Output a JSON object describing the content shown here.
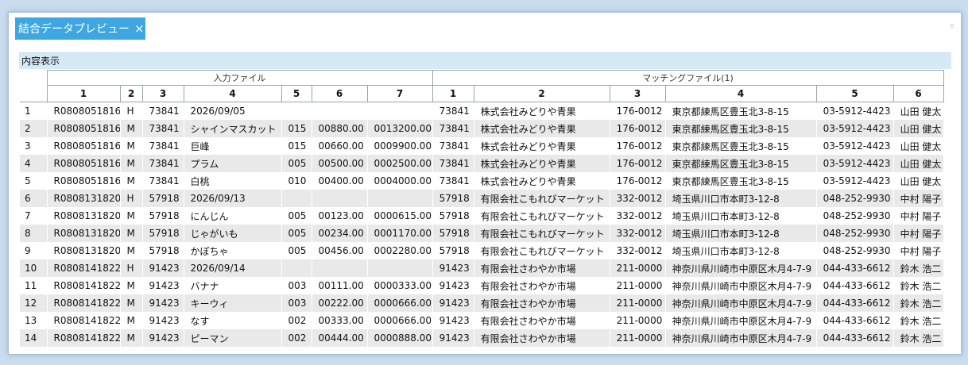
{
  "tab": {
    "title": "結合データプレビュー",
    "close_glyph": "×"
  },
  "tab_menu_glyph": "▿",
  "section": {
    "title": "内容表示"
  },
  "grid": {
    "groups": [
      {
        "label": "入力ファイル"
      },
      {
        "label": "マッチングファイル(1)"
      }
    ],
    "input_columns": [
      "1",
      "2",
      "3",
      "4",
      "5",
      "6",
      "7"
    ],
    "match_columns": [
      "1",
      "2",
      "3",
      "4",
      "5",
      "6"
    ],
    "rows": [
      [
        "1",
        "R0808051816",
        "H",
        "73841",
        "2026/09/05",
        "",
        "",
        "",
        "73841",
        "株式会社みどりや青果",
        "176-0012",
        "東京都練馬区豊玉北3-8-15",
        "03-5912-4423",
        "山田 健太"
      ],
      [
        "2",
        "R0808051816",
        "M",
        "73841",
        "シャインマスカット",
        "015",
        "00880.00",
        "0013200.00",
        "73841",
        "株式会社みどりや青果",
        "176-0012",
        "東京都練馬区豊玉北3-8-15",
        "03-5912-4423",
        "山田 健太"
      ],
      [
        "3",
        "R0808051816",
        "M",
        "73841",
        "巨峰",
        "015",
        "00660.00",
        "0009900.00",
        "73841",
        "株式会社みどりや青果",
        "176-0012",
        "東京都練馬区豊玉北3-8-15",
        "03-5912-4423",
        "山田 健太"
      ],
      [
        "4",
        "R0808051816",
        "M",
        "73841",
        "プラム",
        "005",
        "00500.00",
        "0002500.00",
        "73841",
        "株式会社みどりや青果",
        "176-0012",
        "東京都練馬区豊玉北3-8-15",
        "03-5912-4423",
        "山田 健太"
      ],
      [
        "5",
        "R0808051816",
        "M",
        "73841",
        "白桃",
        "010",
        "00400.00",
        "0004000.00",
        "73841",
        "株式会社みどりや青果",
        "176-0012",
        "東京都練馬区豊玉北3-8-15",
        "03-5912-4423",
        "山田 健太"
      ],
      [
        "6",
        "R0808131820",
        "H",
        "57918",
        "2026/09/13",
        "",
        "",
        "",
        "57918",
        "有限会社こもれびマーケット",
        "332-0012",
        "埼玉県川口市本町3-12-8",
        "048-252-9930",
        "中村 陽子"
      ],
      [
        "7",
        "R0808131820",
        "M",
        "57918",
        "にんじん",
        "005",
        "00123.00",
        "0000615.00",
        "57918",
        "有限会社こもれびマーケット",
        "332-0012",
        "埼玉県川口市本町3-12-8",
        "048-252-9930",
        "中村 陽子"
      ],
      [
        "8",
        "R0808131820",
        "M",
        "57918",
        "じゃがいも",
        "005",
        "00234.00",
        "0001170.00",
        "57918",
        "有限会社こもれびマーケット",
        "332-0012",
        "埼玉県川口市本町3-12-8",
        "048-252-9930",
        "中村 陽子"
      ],
      [
        "9",
        "R0808131820",
        "M",
        "57918",
        "かぼちゃ",
        "005",
        "00456.00",
        "0002280.00",
        "57918",
        "有限会社こもれびマーケット",
        "332-0012",
        "埼玉県川口市本町3-12-8",
        "048-252-9930",
        "中村 陽子"
      ],
      [
        "10",
        "R0808141822",
        "H",
        "91423",
        "2026/09/14",
        "",
        "",
        "",
        "91423",
        "有限会社さわやか市場",
        "211-0000",
        "神奈川県川崎市中原区木月4-7-9",
        "044-433-6612",
        "鈴木 浩二"
      ],
      [
        "11",
        "R0808141822",
        "M",
        "91423",
        "バナナ",
        "003",
        "00111.00",
        "0000333.00",
        "91423",
        "有限会社さわやか市場",
        "211-0000",
        "神奈川県川崎市中原区木月4-7-9",
        "044-433-6612",
        "鈴木 浩二"
      ],
      [
        "12",
        "R0808141822",
        "M",
        "91423",
        "キーウィ",
        "003",
        "00222.00",
        "0000666.00",
        "91423",
        "有限会社さわやか市場",
        "211-0000",
        "神奈川県川崎市中原区木月4-7-9",
        "044-433-6612",
        "鈴木 浩二"
      ],
      [
        "13",
        "R0808141822",
        "M",
        "91423",
        "なす",
        "002",
        "00333.00",
        "0000666.00",
        "91423",
        "有限会社さわやか市場",
        "211-0000",
        "神奈川県川崎市中原区木月4-7-9",
        "044-433-6612",
        "鈴木 浩二"
      ],
      [
        "14",
        "R0808141822",
        "M",
        "91423",
        "ピーマン",
        "002",
        "00444.00",
        "0000888.00",
        "91423",
        "有限会社さわやか市場",
        "211-0000",
        "神奈川県川崎市中原区木月4-7-9",
        "044-433-6612",
        "鈴木 浩二"
      ]
    ]
  }
}
